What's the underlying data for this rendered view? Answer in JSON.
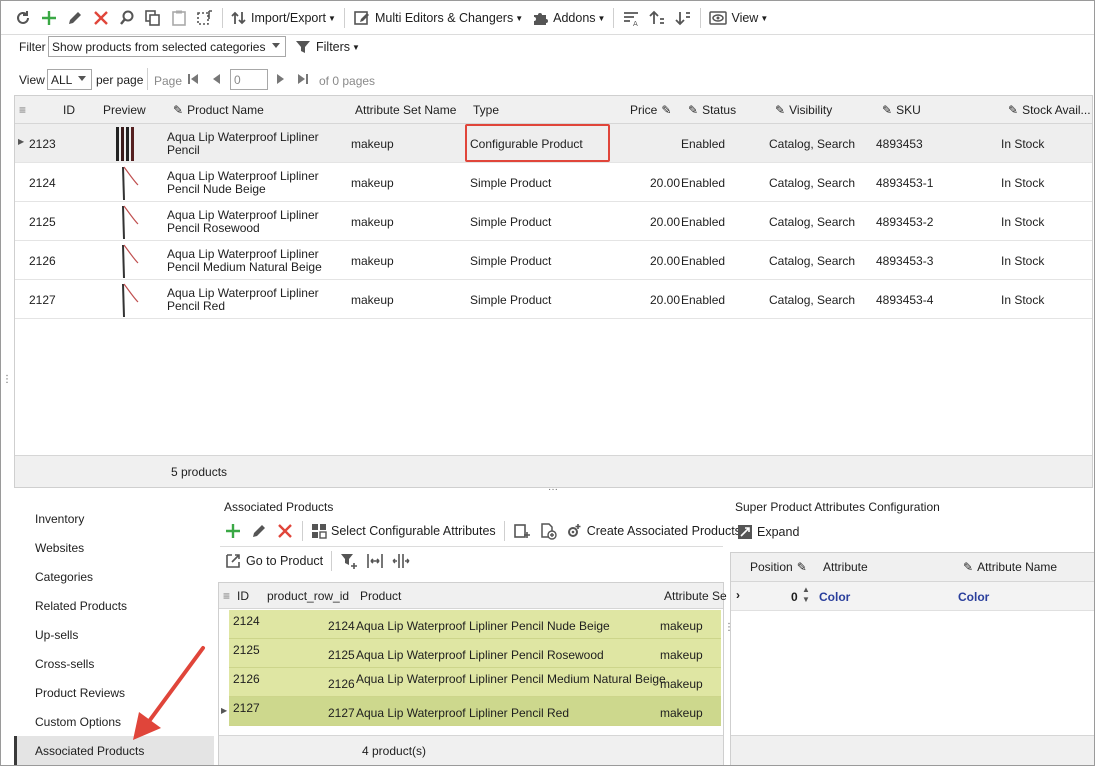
{
  "toolbar": {
    "import_export": "Import/Export",
    "multi_editors": "Multi Editors & Changers",
    "addons": "Addons",
    "view": "View"
  },
  "filter": {
    "label": "Filter",
    "value": "Show products from selected categories",
    "filters_btn": "Filters"
  },
  "pager": {
    "view_label": "View",
    "view_value": "ALL",
    "per_page": "per page",
    "page_label": "Page",
    "page_value": "0",
    "of_pages": "of 0 pages"
  },
  "grid": {
    "columns": [
      "ID",
      "Preview",
      "Product Name",
      "Attribute Set Name",
      "Type",
      "Price",
      "Status",
      "Visibility",
      "SKU",
      "Stock Avail..."
    ],
    "rows": [
      {
        "id": "2123",
        "name": "Aqua Lip Waterproof Lipliner Pencil",
        "set": "makeup",
        "type": "Configurable Product",
        "price": "",
        "status": "Enabled",
        "visibility": "Catalog, Search",
        "sku": "4893453",
        "stock": "In Stock"
      },
      {
        "id": "2124",
        "name": "Aqua Lip Waterproof Lipliner Pencil Nude Beige",
        "set": "makeup",
        "type": "Simple Product",
        "price": "20.00",
        "status": "Enabled",
        "visibility": "Catalog, Search",
        "sku": "4893453-1",
        "stock": "In Stock"
      },
      {
        "id": "2125",
        "name": "Aqua Lip Waterproof Lipliner Pencil Rosewood",
        "set": "makeup",
        "type": "Simple Product",
        "price": "20.00",
        "status": "Enabled",
        "visibility": "Catalog, Search",
        "sku": "4893453-2",
        "stock": "In Stock"
      },
      {
        "id": "2126",
        "name": "Aqua Lip Waterproof Lipliner Pencil Medium Natural Beige",
        "set": "makeup",
        "type": "Simple Product",
        "price": "20.00",
        "status": "Enabled",
        "visibility": "Catalog, Search",
        "sku": "4893453-3",
        "stock": "In Stock"
      },
      {
        "id": "2127",
        "name": "Aqua Lip Waterproof Lipliner Pencil Red",
        "set": "makeup",
        "type": "Simple Product",
        "price": "20.00",
        "status": "Enabled",
        "visibility": "Catalog, Search",
        "sku": "4893453-4",
        "stock": "In Stock"
      }
    ],
    "footer": "5 products"
  },
  "nav": {
    "items": [
      "Inventory",
      "Websites",
      "Categories",
      "Related Products",
      "Up-sells",
      "Cross-sells",
      "Product Reviews",
      "Custom Options",
      "Associated Products"
    ]
  },
  "assoc": {
    "title": "Associated Products",
    "select_config": "Select Configurable Attributes",
    "create_assoc": "Create Associated Products",
    "go_to_product": "Go to Product",
    "columns": [
      "ID",
      "product_row_id",
      "Product",
      "Attribute Se"
    ],
    "rows": [
      {
        "id": "2124",
        "row_id": "2124",
        "product": "Aqua Lip Waterproof Lipliner Pencil Nude Beige",
        "set": "makeup"
      },
      {
        "id": "2125",
        "row_id": "2125",
        "product": "Aqua Lip Waterproof Lipliner Pencil Rosewood",
        "set": "makeup"
      },
      {
        "id": "2126",
        "row_id": "2126",
        "product": "Aqua Lip Waterproof Lipliner Pencil Medium Natural Beige",
        "set": "makeup"
      },
      {
        "id": "2127",
        "row_id": "2127",
        "product": "Aqua Lip Waterproof Lipliner Pencil Red",
        "set": "makeup"
      }
    ],
    "footer": "4 product(s)"
  },
  "super": {
    "title": "Super Product Attributes Configuration",
    "expand": "Expand",
    "columns": [
      "Position",
      "Attribute",
      "Attribute Name"
    ],
    "row": {
      "position": "0",
      "attribute": "Color",
      "attribute_name": "Color"
    }
  },
  "colors": {
    "accent_red": "#e0453a",
    "highlight_green": "#dfe6a3",
    "link_blue": "#2a3f9c"
  }
}
